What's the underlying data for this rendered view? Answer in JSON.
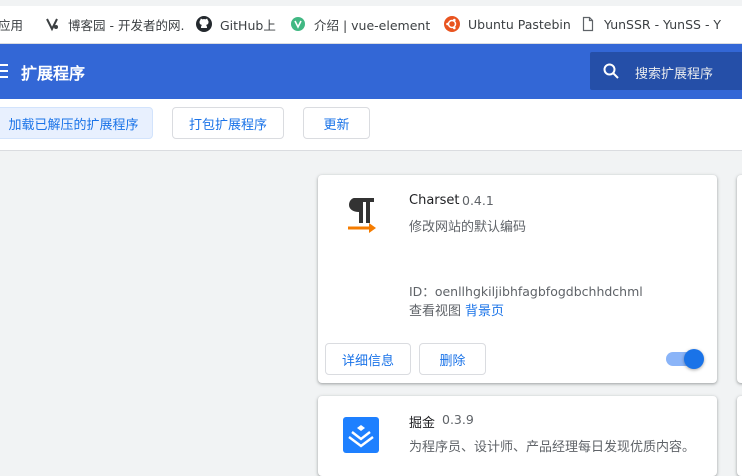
{
  "bookmarks": [
    {
      "label": "应用",
      "icon": "apps-icon"
    },
    {
      "label": "博客园 - 开发者的网...",
      "icon": "cnblogs-icon"
    },
    {
      "label": "GitHub上",
      "icon": "github-icon"
    },
    {
      "label": "介绍 | vue-element-",
      "icon": "vue-icon"
    },
    {
      "label": "Ubuntu Pastebin",
      "icon": "ubuntu-icon"
    },
    {
      "label": "YunSSR - YunSS - Y",
      "icon": "document-icon"
    }
  ],
  "appbar": {
    "title": "扩展程序",
    "search_placeholder": "搜索扩展程序",
    "color": "#3367d6"
  },
  "toolbar": {
    "load_unpacked": "加载已解压的扩展程序",
    "pack_extension": "打包扩展程序",
    "update": "更新"
  },
  "extensions": [
    {
      "name": "Charset",
      "version": "0.4.1",
      "description": "修改网站的默认编码",
      "id_label": "ID：",
      "id": "oenllhgkiljibhfagbfogdbchhdchml",
      "views_label": "查看视图",
      "views_link": "背景页",
      "details_button": "详细信息",
      "remove_button": "删除",
      "enabled": true,
      "icon": "pilcrow-icon"
    },
    {
      "name": "掘金",
      "version": "0.3.9",
      "description": "为程序员、设计师、产品经理每日发现优质内容。",
      "icon": "juejin-icon"
    }
  ]
}
